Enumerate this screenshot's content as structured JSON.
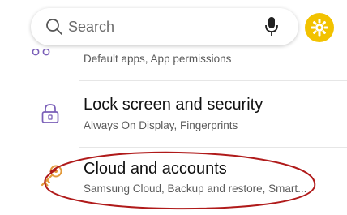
{
  "search": {
    "placeholder": "Search"
  },
  "icons": {
    "search": "search-icon",
    "mic": "microphone-icon",
    "settings_avatar": "gear-icon",
    "apps": "apps-icon",
    "lock": "lock-icon",
    "key": "key-icon"
  },
  "items": [
    {
      "title": "",
      "subtitle": "Default apps, App permissions"
    },
    {
      "title": "Lock screen and security",
      "subtitle": "Always On Display, Fingerprints"
    },
    {
      "title": "Cloud and accounts",
      "subtitle": "Samsung Cloud, Backup and restore, Smart..."
    }
  ],
  "colors": {
    "accent": "#7a5fb8",
    "avatar": "#f2c200",
    "key_icon": "#e39a3b",
    "annotation": "#b01a1a"
  }
}
